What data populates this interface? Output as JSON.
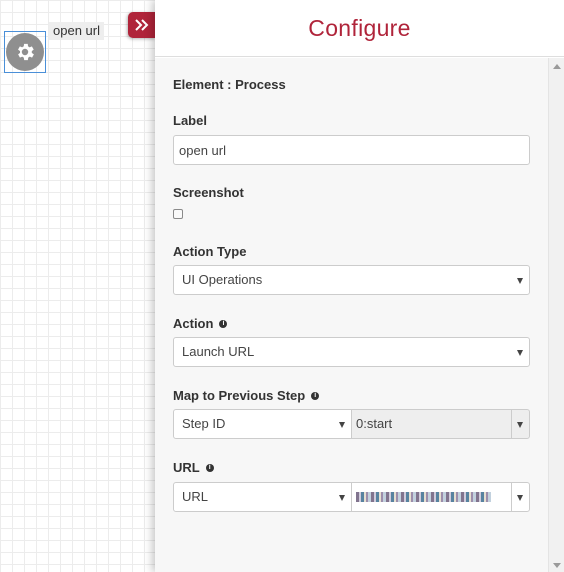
{
  "canvas": {
    "node_label": "open url"
  },
  "panel": {
    "title": "Configure",
    "element_heading": "Element : Process",
    "label_field": {
      "label": "Label",
      "value": "open url"
    },
    "screenshot_field": {
      "label": "Screenshot",
      "checked": false
    },
    "action_type": {
      "label": "Action Type",
      "selected": "UI Operations"
    },
    "action": {
      "label": "Action",
      "selected": "Launch URL"
    },
    "map_prev": {
      "label": "Map to Previous Step",
      "left_selected": "Step ID",
      "right_value": "0:start"
    },
    "url": {
      "label": "URL",
      "left_selected": "URL"
    }
  },
  "colors": {
    "accent": "#b0243a"
  },
  "icons": {
    "node": "gear-icon",
    "toggle": "double-chevron-right-icon",
    "help": "info-icon"
  }
}
